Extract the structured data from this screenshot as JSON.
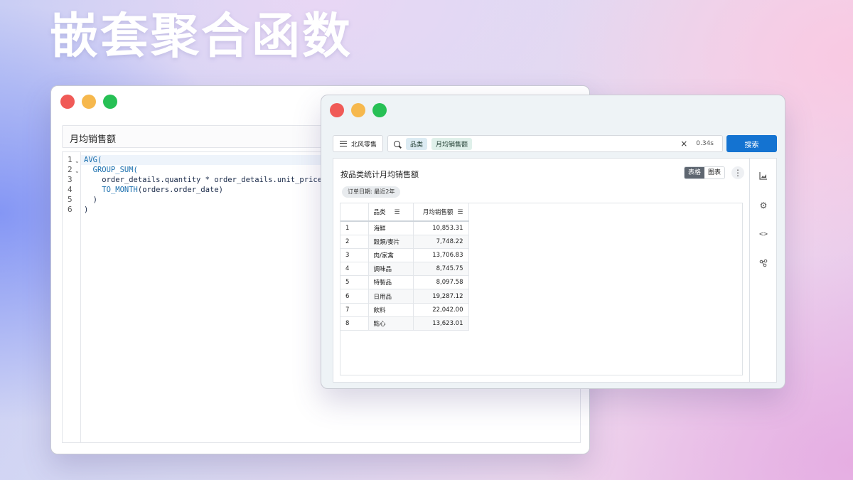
{
  "hero": {
    "title": "嵌套聚合函数"
  },
  "editor": {
    "header": "月均销售额",
    "lines": [
      {
        "no": "1",
        "text": "AVG("
      },
      {
        "no": "2",
        "text": "  GROUP_SUM("
      },
      {
        "no": "3",
        "text": "    order_details.quantity * order_details.unit_price,"
      },
      {
        "no": "4",
        "text": "    TO_MONTH(orders.order_date)"
      },
      {
        "no": "5",
        "text": "  )"
      },
      {
        "no": "6",
        "text": ")"
      }
    ]
  },
  "app": {
    "brand": "北风零售",
    "search": {
      "chips": [
        "品类",
        "月均销售额"
      ],
      "clear": "×",
      "time": "0.34s",
      "button": "搜索"
    },
    "panel": {
      "title": "按品类统计月均销售额",
      "view_table": "表格",
      "view_chart": "图表",
      "more": "⋮",
      "filter": "订单日期: 最近2年"
    },
    "table": {
      "columns": [
        "品类",
        "月均销售额"
      ],
      "rows": [
        {
          "no": "1",
          "category": "海鮮",
          "value": "10,853.31"
        },
        {
          "no": "2",
          "category": "穀類/麥片",
          "value": "7,748.22"
        },
        {
          "no": "3",
          "category": "肉/家禽",
          "value": "13,706.83"
        },
        {
          "no": "4",
          "category": "調味品",
          "value": "8,745.75"
        },
        {
          "no": "5",
          "category": "特製品",
          "value": "8,097.58"
        },
        {
          "no": "6",
          "category": "日用品",
          "value": "19,287.12"
        },
        {
          "no": "7",
          "category": "飲料",
          "value": "22,042.00"
        },
        {
          "no": "8",
          "category": "點心",
          "value": "13,623.01"
        }
      ]
    },
    "side_icons": [
      "chart-icon",
      "gear-icon",
      "code-icon",
      "share-icon"
    ]
  }
}
